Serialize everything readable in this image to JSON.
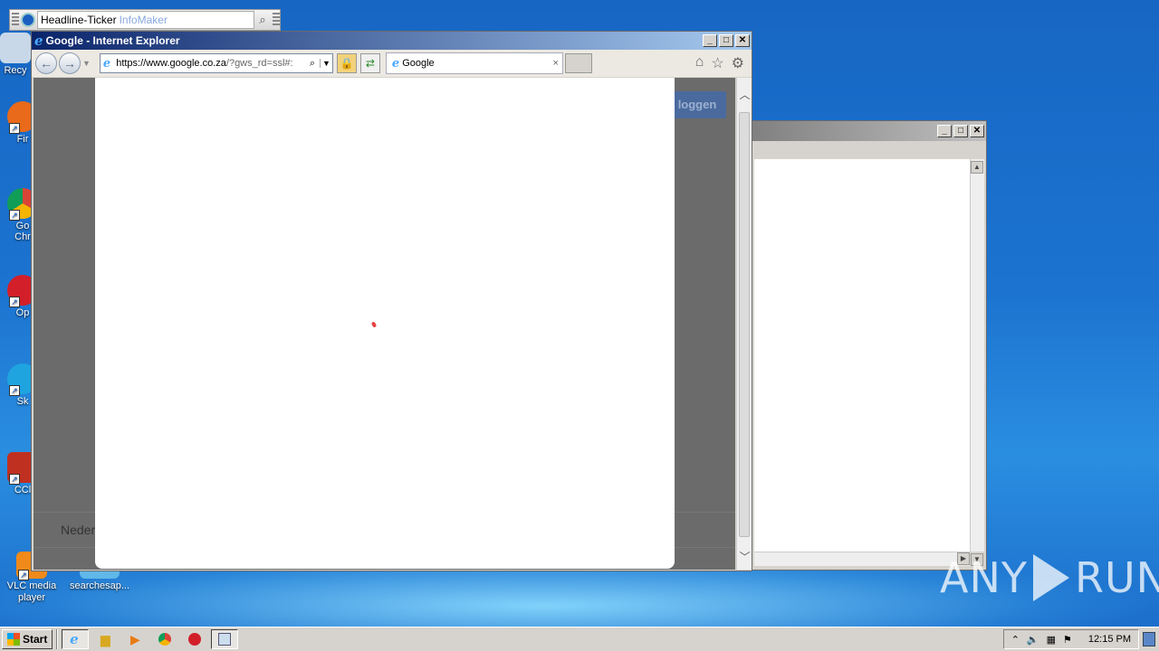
{
  "desktop": {
    "icons": [
      {
        "label": "Recy",
        "color": "#c8d8e8"
      },
      {
        "label": "Fir",
        "color": "#e86a1a"
      },
      {
        "label": "Go\nChr",
        "color": "#2da44e"
      },
      {
        "label": "Op",
        "color": "#d21f2a"
      },
      {
        "label": "Sk",
        "color": "#1fa4e0"
      },
      {
        "label": "CCl",
        "color": "#c03020"
      },
      {
        "label": "VLC media player",
        "color": "#f08a1a"
      },
      {
        "label": "searchesap...",
        "color": "#60b8e8"
      }
    ]
  },
  "ticker": {
    "title": "Headline-Ticker",
    "brand": "InfoMaker"
  },
  "ie": {
    "window_title": "Google - Internet Explorer",
    "address_url": "https://www.google.co.za",
    "address_url_rest": "/?gws_rd=ssl#:",
    "tab_title": "Google",
    "tab_close": "×",
    "page_button": "loggen",
    "footer_text": "Neder"
  },
  "window_buttons": {
    "minimize": "_",
    "maximize": "□",
    "close": "✕"
  },
  "watermark": {
    "left": "ANY",
    "right": "RUN"
  },
  "taskbar": {
    "start_label": "Start",
    "clock": "12:15 PM"
  },
  "colors": {
    "title_active": "#0a246a",
    "title_inactive": "#808080",
    "accent_button": "#4a6a9e"
  }
}
